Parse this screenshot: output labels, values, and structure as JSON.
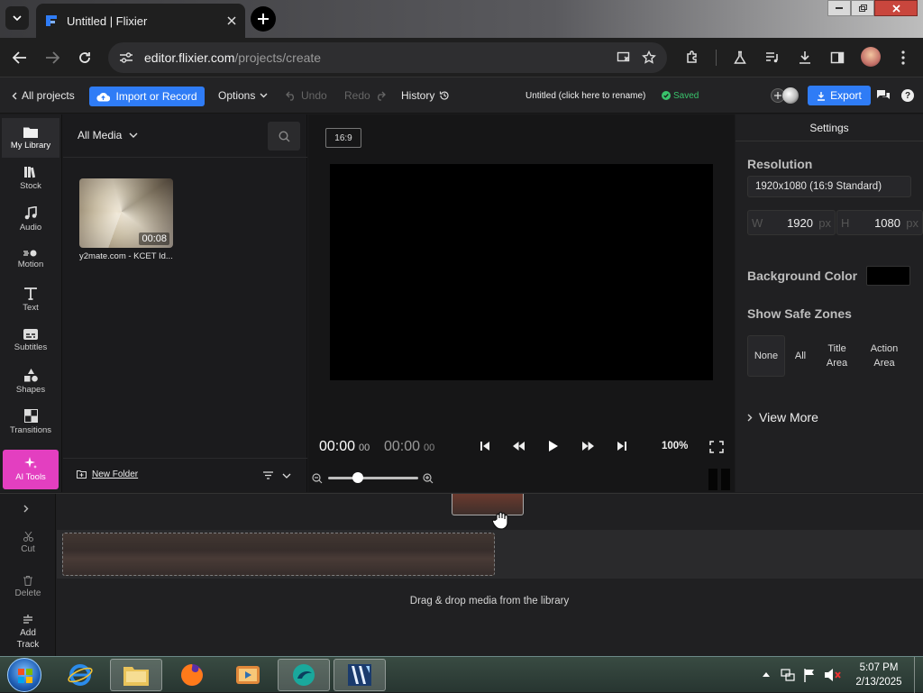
{
  "browser": {
    "tab_title": "Untitled | Flixier",
    "url_host": "editor.flixier.com",
    "url_path": "/projects/create"
  },
  "toolbar": {
    "all_projects": "All projects",
    "import_label": "Import or Record",
    "options": "Options",
    "undo": "Undo",
    "redo": "Redo",
    "history": "History",
    "project_name": "Untitled (click here to rename)",
    "saved": "Saved",
    "export": "Export"
  },
  "rail": {
    "items": [
      {
        "label": "My Library"
      },
      {
        "label": "Stock"
      },
      {
        "label": "Audio"
      },
      {
        "label": "Motion"
      },
      {
        "label": "Text"
      },
      {
        "label": "Subtitles"
      },
      {
        "label": "Shapes"
      },
      {
        "label": "Transitions"
      }
    ],
    "ai_tools": "AI Tools"
  },
  "library": {
    "filter": "All Media",
    "media": [
      {
        "name": "y2mate.com - KCET Id...",
        "duration": "00:08"
      }
    ],
    "new_folder": "New Folder"
  },
  "preview": {
    "ratio": "16:9",
    "time_current": "00:00",
    "time_current_frames": "00",
    "time_total": "00:00",
    "time_total_frames": "00",
    "zoom": "100%",
    "zoom_slider_fraction": 0.33
  },
  "settings": {
    "title": "Settings",
    "resolution_label": "Resolution",
    "resolution_value": "1920x1080 (16:9 Standard)",
    "width_label": "W",
    "width_value": "1920",
    "height_label": "H",
    "height_value": "1080",
    "unit": "px",
    "bg_color_label": "Background Color",
    "bg_color_value": "#000000",
    "safe_zones_label": "Show Safe Zones",
    "safe_zones": [
      "None",
      "All",
      "Title Area",
      "Action Area"
    ],
    "view_more": "View More"
  },
  "timeline": {
    "tools": [
      {
        "label": "Cut"
      },
      {
        "label": "Delete"
      },
      {
        "label": "Add Track"
      }
    ],
    "drop_hint": "Drag & drop media from the library"
  },
  "taskbar": {
    "time": "5:07 PM",
    "date": "2/13/2025"
  },
  "colors": {
    "accent": "#2f7cf6",
    "ai_tools": "#e33fc0",
    "saved": "#39c26b"
  }
}
